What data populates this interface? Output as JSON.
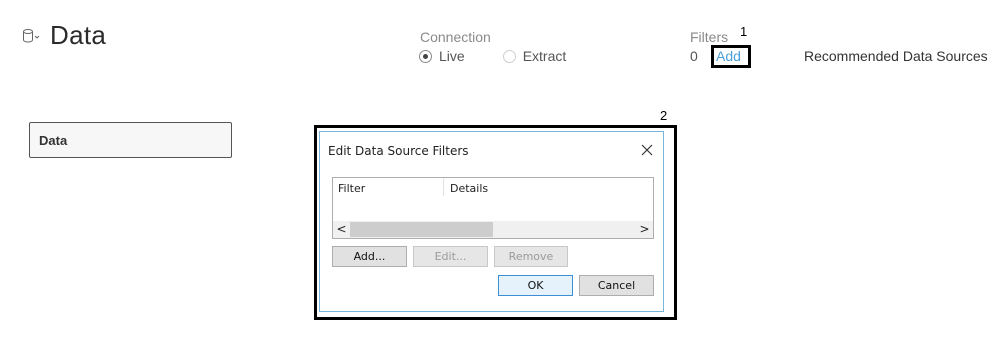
{
  "header": {
    "title": "Data",
    "icon": "database-icon"
  },
  "connection": {
    "label": "Connection",
    "options": [
      {
        "label": "Live",
        "selected": true
      },
      {
        "label": "Extract",
        "selected": false
      }
    ]
  },
  "filters": {
    "label": "Filters",
    "count": "0",
    "add_label": "Add"
  },
  "recommended": {
    "label": "Recommended Data Sources"
  },
  "data_box": {
    "label": "Data"
  },
  "callouts": {
    "one": "1",
    "two": "2"
  },
  "dialog": {
    "title": "Edit Data Source Filters",
    "columns": [
      "Filter",
      "Details"
    ],
    "buttons": {
      "add": "Add...",
      "edit": "Edit...",
      "remove": "Remove",
      "ok": "OK",
      "cancel": "Cancel"
    }
  },
  "colors": {
    "link": "#4a9fd8",
    "dialog_border": "#7ab4d8",
    "default_button_border": "#3c8fd4"
  }
}
